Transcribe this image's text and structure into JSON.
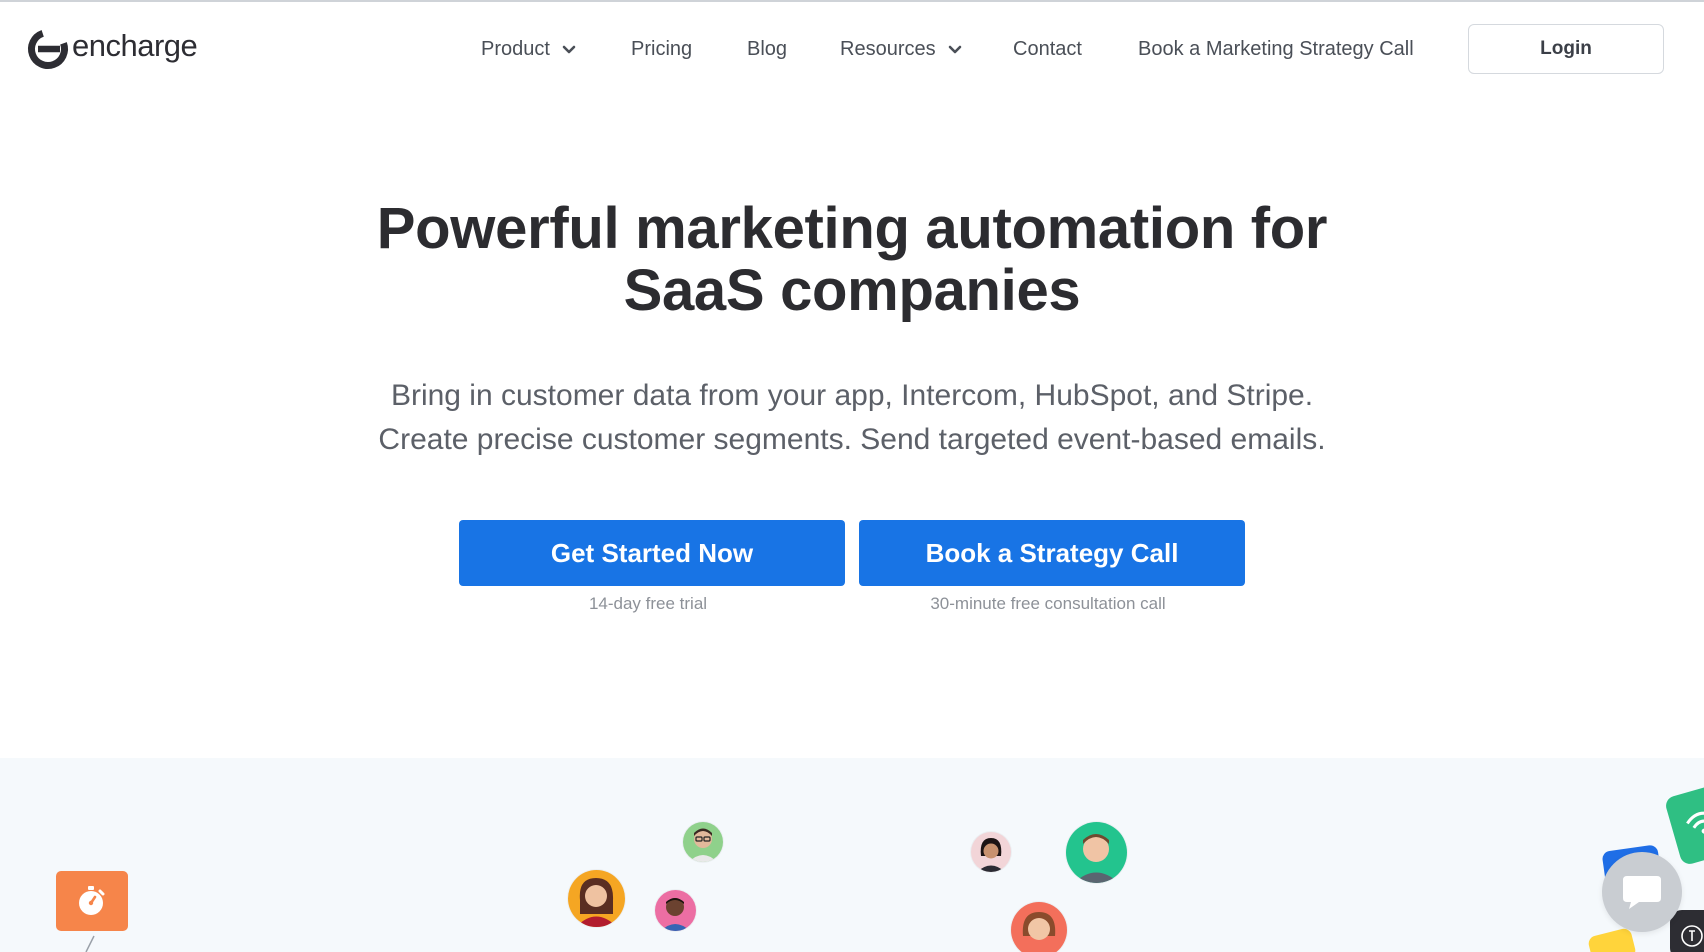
{
  "brand": {
    "name": "encharge",
    "color": "#2d2d33"
  },
  "nav": {
    "items": [
      {
        "label": "Product",
        "has_dropdown": true
      },
      {
        "label": "Pricing",
        "has_dropdown": false
      },
      {
        "label": "Blog",
        "has_dropdown": false
      },
      {
        "label": "Resources",
        "has_dropdown": true
      },
      {
        "label": "Contact",
        "has_dropdown": false
      },
      {
        "label": "Book a Marketing Strategy Call",
        "has_dropdown": false
      }
    ],
    "login_label": "Login"
  },
  "hero": {
    "title_line1": "Powerful marketing automation for",
    "title_line2": "SaaS companies",
    "subtitle_line1": "Bring in customer data from your app, Intercom, HubSpot, and Stripe.",
    "subtitle_line2": "Create precise customer segments. Send targeted event-based emails."
  },
  "cta": {
    "primary_label": "Get Started Now",
    "primary_note": "14-day free trial",
    "secondary_label": "Book a Strategy Call",
    "secondary_note": "30-minute free consultation call"
  },
  "colors": {
    "accent": "#1874e5",
    "band_background": "#f5f9fc",
    "timer_tile": "#f6854a",
    "chat_bubble": "#c9cdd2"
  },
  "icons": [
    "chevron-down-icon",
    "stopwatch-icon",
    "chat-icon",
    "user-avatar"
  ]
}
